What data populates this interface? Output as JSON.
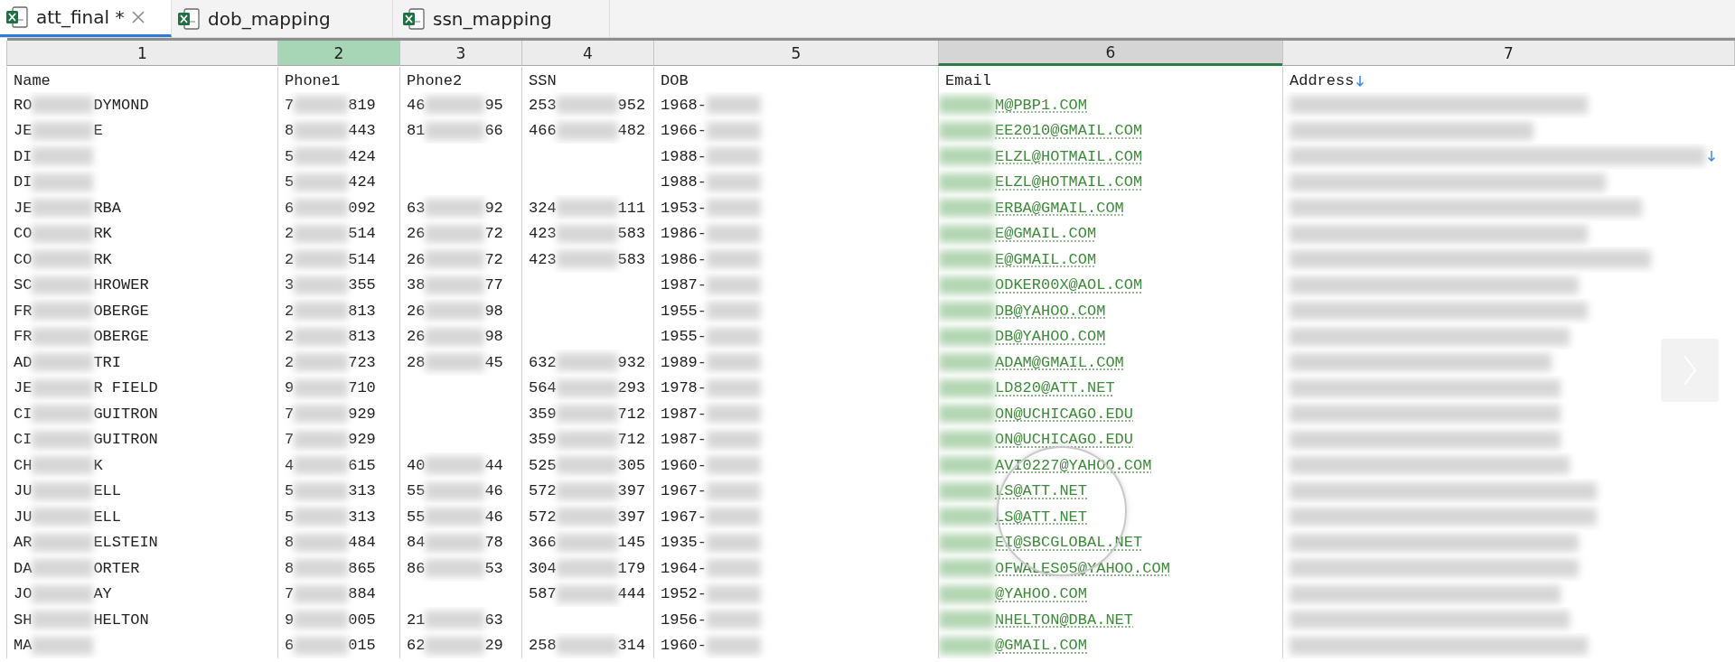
{
  "tabs": [
    {
      "label": "att_final *",
      "selected": true,
      "closable": true
    },
    {
      "label": "dob_mapping",
      "selected": false,
      "closable": false
    },
    {
      "label": "ssn_mapping",
      "selected": false,
      "closable": false
    }
  ],
  "columns": [
    {
      "number": "1",
      "label": "Name",
      "selected": false,
      "current": false,
      "overflow_mark": false
    },
    {
      "number": "2",
      "label": "Phone1",
      "selected": true,
      "current": false,
      "overflow_mark": false
    },
    {
      "number": "3",
      "label": "Phone2",
      "selected": false,
      "current": false,
      "overflow_mark": false
    },
    {
      "number": "4",
      "label": "SSN",
      "selected": false,
      "current": false,
      "overflow_mark": false
    },
    {
      "number": "5",
      "label": "DOB",
      "selected": false,
      "current": false,
      "overflow_mark": false
    },
    {
      "number": "6",
      "label": "Email",
      "selected": false,
      "current": true,
      "overflow_mark": false
    },
    {
      "number": "7",
      "label": "Address",
      "selected": false,
      "current": false,
      "overflow_mark": true
    }
  ],
  "rows": [
    {
      "name": {
        "head": "RO",
        "tail": "DYMOND"
      },
      "phone1": {
        "head": "7",
        "tail": "819"
      },
      "phone2": {
        "head": "46",
        "tail": "95"
      },
      "ssn": {
        "head": "253",
        "tail": "952"
      },
      "dob": {
        "head": "1968-"
      },
      "email": {
        "tail": "M@PBP1.COM"
      },
      "address": {
        "redacted": true,
        "overflow_mark": false
      }
    },
    {
      "name": {
        "head": "JE",
        "tail": "E"
      },
      "phone1": {
        "head": "8",
        "tail": "443"
      },
      "phone2": {
        "head": "81",
        "tail": "66"
      },
      "ssn": {
        "head": "466",
        "tail": "482"
      },
      "dob": {
        "head": "1966-"
      },
      "email": {
        "tail": "EE2010@GMAIL.COM"
      },
      "address": {
        "redacted": true,
        "overflow_mark": false
      }
    },
    {
      "name": {
        "head": "DI"
      },
      "phone1": {
        "head": "5",
        "tail": "424"
      },
      "dob": {
        "head": "1988-"
      },
      "email": {
        "tail": "ELZL@HOTMAIL.COM"
      },
      "address": {
        "redacted": true,
        "overflow_mark": true
      }
    },
    {
      "name": {
        "head": "DI"
      },
      "phone1": {
        "head": "5",
        "tail": "424"
      },
      "dob": {
        "head": "1988-"
      },
      "email": {
        "tail": "ELZL@HOTMAIL.COM"
      },
      "address": {
        "redacted": true,
        "overflow_mark": false
      }
    },
    {
      "name": {
        "head": "JE",
        "tail": "RBA"
      },
      "phone1": {
        "head": "6",
        "tail": "092"
      },
      "phone2": {
        "head": "63",
        "tail": "92"
      },
      "ssn": {
        "head": "324",
        "tail": "111"
      },
      "dob": {
        "head": "1953-"
      },
      "email": {
        "tail": "ERBA@GMAIL.COM"
      },
      "address": {
        "redacted": true,
        "overflow_mark": false
      }
    },
    {
      "name": {
        "head": "CO",
        "tail": "RK"
      },
      "phone1": {
        "head": "2",
        "tail": "514"
      },
      "phone2": {
        "head": "26",
        "tail": "72"
      },
      "ssn": {
        "head": "423",
        "tail": "583"
      },
      "dob": {
        "head": "1986-"
      },
      "email": {
        "tail": "E@GMAIL.COM"
      },
      "address": {
        "redacted": true,
        "overflow_mark": false
      }
    },
    {
      "name": {
        "head": "CO",
        "tail": "RK"
      },
      "phone1": {
        "head": "2",
        "tail": "514"
      },
      "phone2": {
        "head": "26",
        "tail": "72"
      },
      "ssn": {
        "head": "423",
        "tail": "583"
      },
      "dob": {
        "head": "1986-"
      },
      "email": {
        "tail": "E@GMAIL.COM"
      },
      "address": {
        "redacted": true,
        "overflow_mark": false
      }
    },
    {
      "name": {
        "head": "SC",
        "tail": "HROWER"
      },
      "phone1": {
        "head": "3",
        "tail": "355"
      },
      "phone2": {
        "head": "38",
        "tail": "77"
      },
      "dob": {
        "head": "1987-"
      },
      "email": {
        "tail": "ODKER00X@AOL.COM"
      },
      "address": {
        "redacted": true,
        "overflow_mark": false
      }
    },
    {
      "name": {
        "head": "FR",
        "tail": "OBERGE"
      },
      "phone1": {
        "head": "2",
        "tail": "813"
      },
      "phone2": {
        "head": "26",
        "tail": "98"
      },
      "dob": {
        "head": "1955-"
      },
      "email": {
        "tail": "DB@YAHOO.COM"
      },
      "address": {
        "redacted": true,
        "overflow_mark": false
      }
    },
    {
      "name": {
        "head": "FR",
        "tail": "OBERGE"
      },
      "phone1": {
        "head": "2",
        "tail": "813"
      },
      "phone2": {
        "head": "26",
        "tail": "98"
      },
      "dob": {
        "head": "1955-"
      },
      "email": {
        "tail": "DB@YAHOO.COM"
      },
      "address": {
        "redacted": true,
        "overflow_mark": false
      }
    },
    {
      "name": {
        "head": "AD",
        "tail": "TRI"
      },
      "phone1": {
        "head": "2",
        "tail": "723"
      },
      "phone2": {
        "head": "28",
        "tail": "45"
      },
      "ssn": {
        "head": "632",
        "tail": "932"
      },
      "dob": {
        "head": "1989-"
      },
      "email": {
        "tail": "ADAM@GMAIL.COM"
      },
      "address": {
        "redacted": true,
        "overflow_mark": false
      }
    },
    {
      "name": {
        "head": "JE",
        "tail": "R FIELD"
      },
      "phone1": {
        "head": "9",
        "tail": "710"
      },
      "ssn": {
        "head": "564",
        "tail": "293"
      },
      "dob": {
        "head": "1978-"
      },
      "email": {
        "tail": "LD820@ATT.NET"
      },
      "address": {
        "redacted": true,
        "overflow_mark": false
      }
    },
    {
      "name": {
        "head": "CI",
        "tail": "GUITRON"
      },
      "phone1": {
        "head": "7",
        "tail": "929"
      },
      "ssn": {
        "head": "359",
        "tail": "712"
      },
      "dob": {
        "head": "1987-"
      },
      "email": {
        "tail": "ON@UCHICAGO.EDU"
      },
      "address": {
        "redacted": true,
        "overflow_mark": false
      }
    },
    {
      "name": {
        "head": "CI",
        "tail": "GUITRON"
      },
      "phone1": {
        "head": "7",
        "tail": "929"
      },
      "ssn": {
        "head": "359",
        "tail": "712"
      },
      "dob": {
        "head": "1987-"
      },
      "email": {
        "tail": "ON@UCHICAGO.EDU"
      },
      "address": {
        "redacted": true,
        "overflow_mark": false
      }
    },
    {
      "name": {
        "head": "CH",
        "tail": "K"
      },
      "phone1": {
        "head": "4",
        "tail": "615"
      },
      "phone2": {
        "head": "40",
        "tail": "44"
      },
      "ssn": {
        "head": "525",
        "tail": "305"
      },
      "dob": {
        "head": "1960-"
      },
      "email": {
        "tail": "AVI0227@YAHOO.COM"
      },
      "address": {
        "redacted": true,
        "overflow_mark": false
      }
    },
    {
      "name": {
        "head": "JU",
        "tail": "ELL"
      },
      "phone1": {
        "head": "5",
        "tail": "313"
      },
      "phone2": {
        "head": "55",
        "tail": "46"
      },
      "ssn": {
        "head": "572",
        "tail": "397"
      },
      "dob": {
        "head": "1967-"
      },
      "email": {
        "tail": "LS@ATT.NET"
      },
      "address": {
        "redacted": true,
        "overflow_mark": false
      }
    },
    {
      "name": {
        "head": "JU",
        "tail": "ELL"
      },
      "phone1": {
        "head": "5",
        "tail": "313"
      },
      "phone2": {
        "head": "55",
        "tail": "46"
      },
      "ssn": {
        "head": "572",
        "tail": "397"
      },
      "dob": {
        "head": "1967-"
      },
      "email": {
        "tail": "LS@ATT.NET"
      },
      "address": {
        "redacted": true,
        "overflow_mark": false
      }
    },
    {
      "name": {
        "head": "AR",
        "tail": "ELSTEIN"
      },
      "phone1": {
        "head": "8",
        "tail": "484"
      },
      "phone2": {
        "head": "84",
        "tail": "78"
      },
      "ssn": {
        "head": "366",
        "tail": "145"
      },
      "dob": {
        "head": "1935-"
      },
      "email": {
        "tail": "EI@SBCGLOBAL.NET"
      },
      "address": {
        "redacted": true,
        "overflow_mark": false
      }
    },
    {
      "name": {
        "head": "DA",
        "tail": "ORTER"
      },
      "phone1": {
        "head": "8",
        "tail": "865"
      },
      "phone2": {
        "head": "86",
        "tail": "53"
      },
      "ssn": {
        "head": "304",
        "tail": "179"
      },
      "dob": {
        "head": "1964-"
      },
      "email": {
        "tail": "OFWALES05@YAHOO.COM"
      },
      "address": {
        "redacted": true,
        "overflow_mark": false
      }
    },
    {
      "name": {
        "head": "JO",
        "tail": "AY"
      },
      "phone1": {
        "head": "7",
        "tail": "884"
      },
      "ssn": {
        "head": "587",
        "tail": "444"
      },
      "dob": {
        "head": "1952-"
      },
      "email": {
        "tail": "@YAHOO.COM"
      },
      "address": {
        "redacted": true,
        "overflow_mark": false
      }
    },
    {
      "name": {
        "head": "SH",
        "tail": "HELTON"
      },
      "phone1": {
        "head": "9",
        "tail": "005"
      },
      "phone2": {
        "head": "21",
        "tail": "63"
      },
      "dob": {
        "head": "1956-"
      },
      "email": {
        "tail": "NHELTON@DBA.NET"
      },
      "address": {
        "redacted": true,
        "overflow_mark": false
      }
    },
    {
      "name": {
        "head": "MA"
      },
      "phone1": {
        "head": "6",
        "tail": "015"
      },
      "phone2": {
        "head": "62",
        "tail": "29"
      },
      "ssn": {
        "head": "258",
        "tail": "314"
      },
      "dob": {
        "head": "1960-"
      },
      "email": {
        "tail": "@GMAIL.COM"
      },
      "address": {
        "redacted": true,
        "overflow_mark": false
      }
    }
  ],
  "magnifier": true,
  "next_arrow": true
}
